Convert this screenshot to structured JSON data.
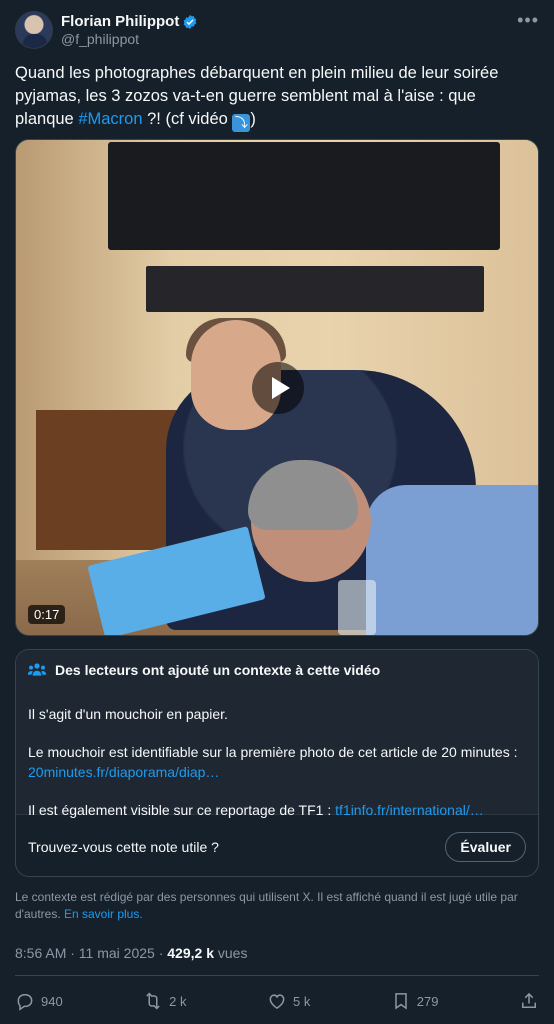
{
  "author": {
    "name": "Florian Philippot",
    "handle": "@f_philippot",
    "verified_color": "#1d9bf0"
  },
  "more_icon": "•••",
  "tweet": {
    "text_part1": "Quand les photographes débarquent en plein milieu de leur soirée pyjamas, les 3 zozos va-t-en guerre semblent mal à l'aise : que planque ",
    "hashtag": "#Macron",
    "text_part2": " ?! (cf vidéo ",
    "emoji": "⤵",
    "text_part3": ")"
  },
  "media": {
    "duration": "0:17",
    "play_icon": "play-icon"
  },
  "note": {
    "header": "Des lecteurs ont ajouté un contexte à cette vidéo",
    "line1": "Il s'agit d'un mouchoir en papier.",
    "line2": "Le mouchoir est identifiable sur la première photo de cet article de 20 minutes : ",
    "link1": "20minutes.fr/diaporama/diap…",
    "line3": "Il est également visible sur ce reportage de TF1 : ",
    "link2": "tf1info.fr/international/…",
    "question": "Trouvez-vous cette note utile ?",
    "rate_button": "Évaluer"
  },
  "disclaimer": {
    "text": "Le contexte est rédigé par des personnes qui utilisent X. Il est affiché quand il est jugé utile par d'autres. ",
    "learn_more": "En savoir plus."
  },
  "meta": {
    "time": "8:56 AM · 11 mai 2025 · ",
    "views_count": "429,2 k",
    "views_label": " vues"
  },
  "actions": {
    "replies": "940",
    "reposts": "2 k",
    "likes": "5 k",
    "bookmarks": "279"
  }
}
